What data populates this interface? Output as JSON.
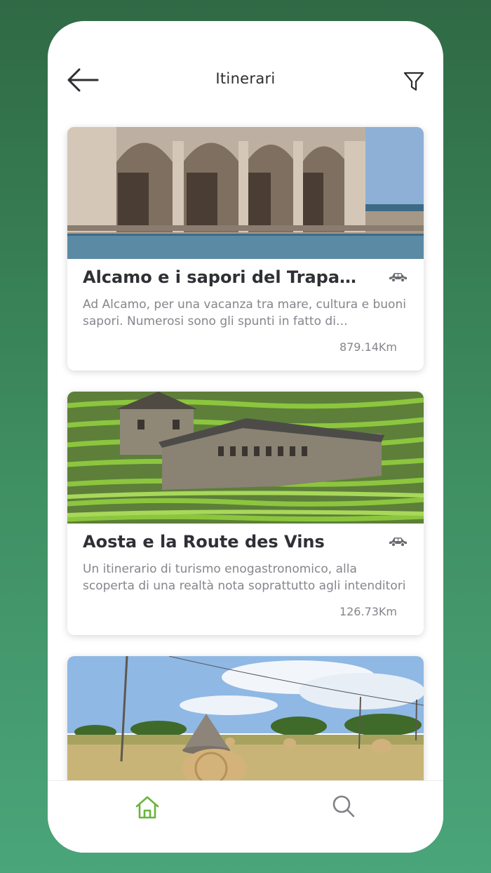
{
  "header": {
    "title": "Itinerari"
  },
  "cards": [
    {
      "title": "Alcamo e i sapori del Trapanese",
      "description": "Ad Alcamo, per una vacanza tra mare, cultura e buoni sapori. Numerosi sono gli spunti in fatto di gastronomia",
      "distance": "879.14Km",
      "transport_icon": "car-icon"
    },
    {
      "title": "Aosta e la Route des Vins",
      "description": "Un itinerario di turismo enogastronomico, alla scoperta di una realtà nota soprattutto agli intenditori",
      "distance": "126.73Km",
      "transport_icon": "car-icon"
    }
  ],
  "nav": {
    "home_icon": "home-icon",
    "search_icon": "search-icon"
  },
  "colors": {
    "accent": "#6ab43c",
    "background": "#3f8f62",
    "text": "#2f3035",
    "muted": "#85858c"
  }
}
